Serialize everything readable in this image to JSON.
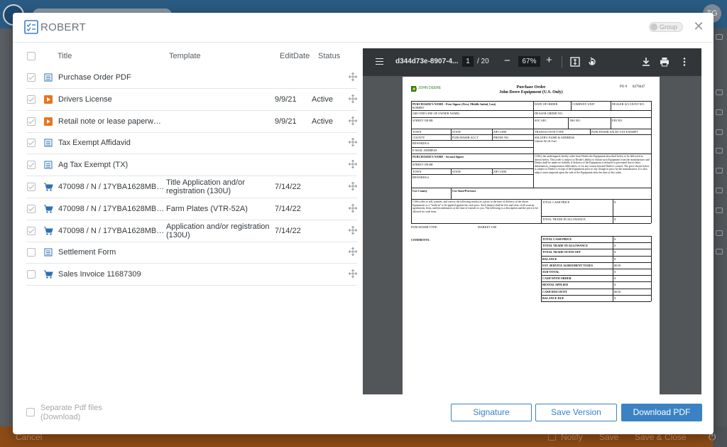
{
  "background": {
    "avatar_initials": "TG",
    "bottom_bar": {
      "cancel": "Cancel",
      "notify": "Notify",
      "save": "Save",
      "save_close": "Save & Close"
    }
  },
  "modal": {
    "title": "ROBERT",
    "group_label": "Group",
    "close_glyph": "✕"
  },
  "list": {
    "headers": {
      "title": "Title",
      "template": "Template",
      "edit_date": "EditDate",
      "status": "Status"
    },
    "rows": [
      {
        "checked": true,
        "icon": "document-list-icon",
        "title": "Purchase Order PDF",
        "template": "",
        "edit_date": "",
        "status": ""
      },
      {
        "checked": true,
        "icon": "play-icon",
        "title": "Drivers License",
        "template": "",
        "edit_date": "9/9/21",
        "status": "Active"
      },
      {
        "checked": true,
        "icon": "play-icon",
        "title": "Retail note or lease paperwork ...",
        "template": "",
        "edit_date": "9/9/21",
        "status": "Active"
      },
      {
        "checked": true,
        "icon": "document-list-icon",
        "title": "Tax Exempt Affidavid",
        "template": "",
        "edit_date": "",
        "status": ""
      },
      {
        "checked": true,
        "icon": "document-list-icon",
        "title": "Ag Tax Exempt (TX)",
        "template": "",
        "edit_date": "",
        "status": ""
      },
      {
        "checked": true,
        "icon": "cart-icon",
        "title": "470098 / N / 17YBA1628MB079...",
        "template": "Title Application and/or registration (130U)",
        "edit_date": "7/14/22",
        "status": ""
      },
      {
        "checked": true,
        "icon": "cart-icon",
        "title": "470098 / N / 17YBA1628MB079...",
        "template": "Farm Plates (VTR-52A)",
        "edit_date": "7/14/22",
        "status": ""
      },
      {
        "checked": true,
        "icon": "cart-icon",
        "title": "470098 / N / 17YBA1628MB079...",
        "template": "Application and/or registration (130U)",
        "edit_date": "7/14/22",
        "status": ""
      },
      {
        "checked": false,
        "icon": "document-list-icon",
        "title": "Settlement Form",
        "template": "",
        "edit_date": "",
        "status": ""
      },
      {
        "checked": false,
        "icon": "cart-icon",
        "title": "Sales Invoice 11687309",
        "template": "",
        "edit_date": "",
        "status": ""
      }
    ],
    "separate_pdf": "Separate Pdf files (Download)"
  },
  "viewer": {
    "file_name": "d344d73e-8907-4...",
    "page_current": "1",
    "page_total": "/ 20",
    "zoom": "67%",
    "document": {
      "brand": "JOHN DEERE",
      "title": "Purchase Order",
      "subtitle": "John Deere Equipment (U.S. Only)",
      "po_label": "PO #",
      "po_number": "8279447",
      "purchaser_first_label": "PURCHASER'S NAME - First Signer (First, Middle Initial, Last)",
      "purchaser_first_value": "ROBERT",
      "date_of_order": "DATE OF ORDER",
      "company_unit": "COMPANY UNIT",
      "dealer_account": "DEALER ACCOUNT NO.",
      "second_line": "(SECOND LINE OF OWNER NAME)",
      "dealer_order": "DEALER ORDER NO.",
      "street": "STREET OR RR",
      "soc_sec": "SOC.SEC.",
      "irs_no": "IRS NO.",
      "ein_no": "EIN NO.",
      "town": "TOWN",
      "state": "STATE",
      "zip": "ZIP CODE",
      "transaction_type": "TRANSACTION TYPE",
      "sales_tax": "PURCHASER SALES TAX EXEMPT",
      "county": "COUNTY",
      "purchaser_acct": "PURCHASER ACCT",
      "phone": "PHONE NO.",
      "seller_label": "SELLER'S NAME & ADDRESS",
      "seller_value": "United AG & Turf",
      "rewards": "REWARDS #",
      "email": "E-MAIL ADDRESS",
      "purchaser_second_label": "PURCHASER'S NAME - Second Signer",
      "use_county": "Use County",
      "use_state": "Use State/Province",
      "we_order": "I (We), the undersigned, hereby order from Dealer the Equipment described below to be delivered as shown below. This order is subject to Dealer's ability to obtain such Equipment from the manufacturer and Dealer shall be under no liability if delivery of the Equipment is delayed or prevented due to labor disturbances, transportation difficulties, or for any reason beyond Dealer's control. The price shown below is subject to Dealer's receipt of the Equipment prior to any change in price by the manufacturer. It is also subject taxes imposed upon the sale of the Equipment after the date of this order.",
      "we_sell": "I (We) offer to sell, transfer, and convey the following item(s) as a prior to the time of delivery of the above Equipment, as a \"trade-in\" to be applied against the cash price. Such item(s) shall be free and clear of all security agreements, liens, and encumbrances at the time of transfer to you. The following is a description and the price to be allowed for such item.",
      "total_cash_price": "TOTAL CASH PRICE",
      "total_trade_allowance": "TOTAL TRADE-IN ALLOWANCE",
      "dollar": "$",
      "purchaser_type": "PURCHASER TYPE:",
      "market_use": "MARKET USE",
      "comments": "COMMENTS:",
      "summary": [
        {
          "label": "TOTAL CASH-PRICE",
          "value": "$"
        },
        {
          "label": "TOTAL TRADE-IN ALLOWANCE",
          "value": "$"
        },
        {
          "label": "TOTAL TRADE-IN PAY-OFF",
          "value": "$"
        },
        {
          "label": "BALANCE",
          "value": "$"
        },
        {
          "label": "EST. SERVICE AGREEMENT TAXES",
          "value": "$0.00"
        },
        {
          "label": "SUB-TOTAL",
          "value": "$"
        },
        {
          "label": "CASH WITH ORDER",
          "value": "$"
        },
        {
          "label": "RENTAL APPLIED",
          "value": "$"
        },
        {
          "label": "CASH DISCOUNT",
          "value": "$0.00"
        },
        {
          "label": "BALANCE DUE",
          "value": "$"
        }
      ]
    }
  },
  "footer": {
    "signature": "Signature",
    "save_version": "Save Version",
    "download_pdf": "Download PDF"
  },
  "colors": {
    "accent": "#3b82c4",
    "orange_bar": "#8d4c16",
    "play_icon": "#e8741e",
    "cart_icon": "#2f6fb0"
  }
}
